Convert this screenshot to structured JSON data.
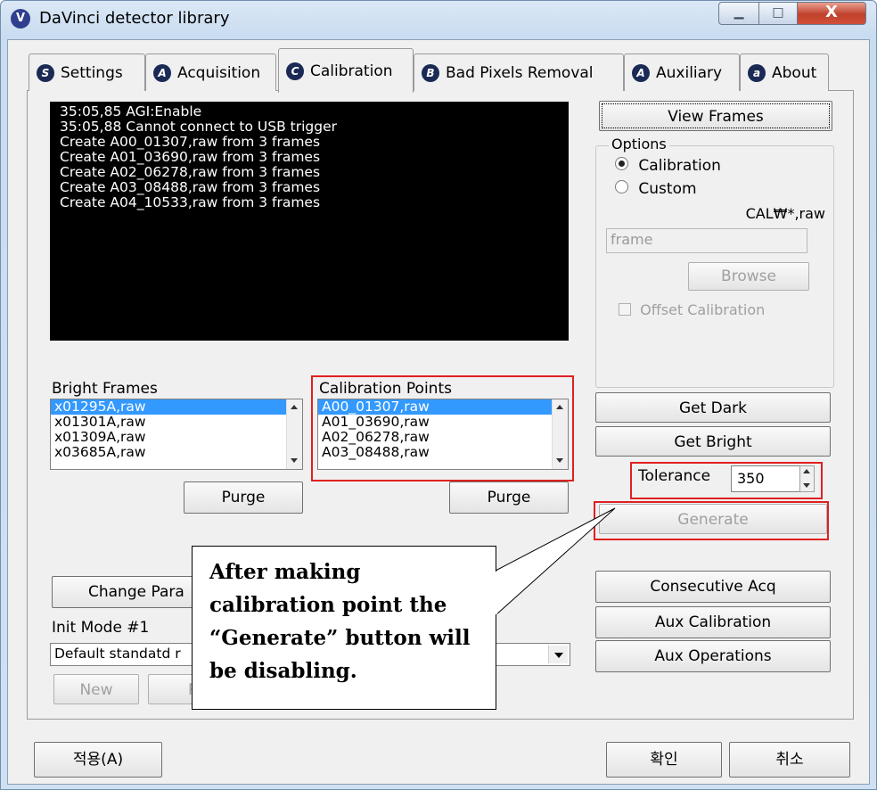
{
  "window": {
    "title": "DaVinci detector library",
    "icon_letter": "V",
    "caption": {
      "minimize": "▁",
      "maximize": "□",
      "close": "X"
    }
  },
  "tabs": [
    {
      "label": "Settings",
      "icon": "S"
    },
    {
      "label": "Acquisition",
      "icon": "A"
    },
    {
      "label": "Calibration",
      "icon": "C",
      "active": true
    },
    {
      "label": "Bad Pixels Removal",
      "icon": "B"
    },
    {
      "label": "Auxiliary",
      "icon": "A"
    },
    {
      "label": "About",
      "icon": "a"
    }
  ],
  "log_lines": [
    "35:05,85 AGI:Enable",
    "35:05,88 Cannot connect to USB trigger",
    "Create A00_01307,raw from 3 frames",
    "Create A01_03690,raw from 3 frames",
    "Create A02_06278,raw from 3 frames",
    "Create A03_08488,raw from 3 frames",
    "Create A04_10533,raw from 3 frames"
  ],
  "right_panel": {
    "view_frames": "View Frames",
    "options_label": "Options",
    "radio_calibration": "Calibration",
    "radio_custom": "Custom",
    "cal_pattern": "CAL₩*,raw",
    "frame_field": "frame",
    "browse": "Browse",
    "offset_calibration": "Offset Calibration",
    "get_dark": "Get Dark",
    "get_bright": "Get Bright",
    "tolerance_label": "Tolerance",
    "tolerance_value": "350",
    "generate": "Generate",
    "consecutive_acq": "Consecutive Acq",
    "aux_calibration": "Aux Calibration",
    "aux_operations": "Aux Operations"
  },
  "bright_frames": {
    "label": "Bright Frames",
    "items": [
      "x01295A,raw",
      "x01301A,raw",
      "x01309A,raw",
      "x03685A,raw"
    ],
    "purge": "Purge"
  },
  "calibration_points": {
    "label": "Calibration Points",
    "items": [
      "A00_01307,raw",
      "A01_03690,raw",
      "A02_06278,raw",
      "A03_08488,raw"
    ],
    "purge": "Purge"
  },
  "left_bottom": {
    "change_params": "Change Para",
    "init_mode_label": "Init Mode #1",
    "init_mode_value": "Default standatd r",
    "new": "New",
    "re": "Re"
  },
  "callout": {
    "lines": [
      "After making",
      "calibration point the",
      "“Generate” button will",
      "be disabling."
    ]
  },
  "footer": {
    "apply": "적용(A)",
    "ok": "확인",
    "cancel": "취소"
  }
}
